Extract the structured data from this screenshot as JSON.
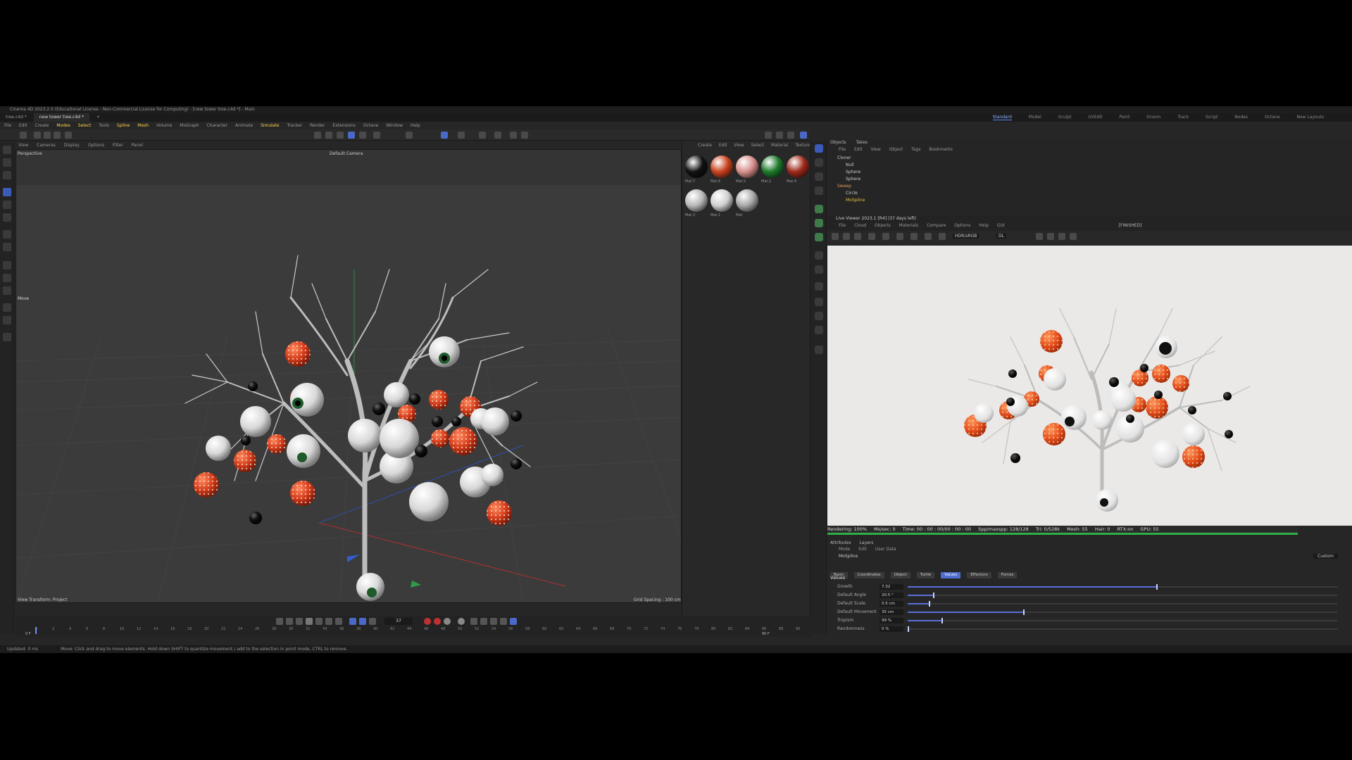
{
  "window": {
    "title": "Cinema 4D 2023.2.0 (Educational License - Non-Commercial License for Computing) - [new tower tree.c4d *] - Main"
  },
  "tabs": [
    {
      "label": "tree.c4d *"
    },
    {
      "label": "new tower tree.c4d *"
    }
  ],
  "layouts": [
    "Standard",
    "Model",
    "Sculpt",
    "UVEdit",
    "Paint",
    "Groom",
    "Track",
    "Script",
    "Nodes",
    "Octane",
    "New Layouts"
  ],
  "menubar": [
    "File",
    "Edit",
    "Create",
    "Modes",
    "Select",
    "Tools",
    "Spline",
    "Mesh",
    "Volume",
    "MoGraph",
    "Character",
    "Animate",
    "Simulate",
    "Tracker",
    "Render",
    "Extensions",
    "Octane",
    "Window",
    "Help"
  ],
  "viewport": {
    "menu": [
      "View",
      "Cameras",
      "Display",
      "Options",
      "Filter",
      "Panel"
    ],
    "label": "Perspective",
    "camera": "Default Camera",
    "move_label": "Move",
    "footer_left": "View Transform: Project",
    "footer_right": "Grid Spacing : 100 cm"
  },
  "materials": {
    "menu": [
      "Create",
      "Edit",
      "View",
      "Select",
      "Material",
      "Texture"
    ],
    "items": [
      {
        "name": "Mat.7",
        "color": "#111111"
      },
      {
        "name": "Mat.6",
        "color": "#c8421e"
      },
      {
        "name": "Mat.5",
        "color": "#d8908c"
      },
      {
        "name": "Mat.2",
        "color": "#1f7a2c"
      },
      {
        "name": "Mat.4",
        "color": "#9e2a1a"
      },
      {
        "name": "Mat.3",
        "color": "#b8b8b8"
      },
      {
        "name": "Mat.1",
        "color": "#d0d0d0"
      },
      {
        "name": "Mat",
        "color": "#a8a8a8"
      }
    ]
  },
  "objects": {
    "tabs": [
      "Objects",
      "Takes"
    ],
    "menu": [
      "File",
      "Edit",
      "View",
      "Object",
      "Tags",
      "Bookmarks"
    ],
    "rows": [
      {
        "name": "Cloner",
        "indent": 0
      },
      {
        "name": "Null",
        "indent": 1
      },
      {
        "name": "Sphere",
        "indent": 1
      },
      {
        "name": "Sphere",
        "indent": 1
      },
      {
        "name": "Sweep",
        "indent": 0,
        "color": "#e0a060"
      },
      {
        "name": "Circle",
        "indent": 1
      },
      {
        "name": "MoSpline",
        "indent": 1,
        "color": "#e8c040"
      }
    ]
  },
  "live_viewer": {
    "title": "Live Viewer 2023.1 [R4] (37 days left)",
    "menu": [
      "File",
      "Cloud",
      "Objects",
      "Materials",
      "Compare",
      "Options",
      "Help",
      "GUI"
    ],
    "finished": "[FINISHED]",
    "mode": "HDR/sRGB",
    "channel": "DL"
  },
  "render_status": {
    "rendering": "Rendering: 100%",
    "mssec": "Ms/sec: 0",
    "time": "Time: 00 : 00 : 00/00 : 00 : 00",
    "spp": "Spp/maxspp: 128/128",
    "tri": "Tri: 0/528k",
    "mesh": "Mesh: 55",
    "hair": "Hair: 0",
    "rtx": "RTX:on",
    "gpu": "GPU: 55"
  },
  "attributes": {
    "tabs": [
      "Attributes",
      "Layers"
    ],
    "mode": [
      "Mode",
      "Edit",
      "User Data"
    ],
    "object": "MoSpline",
    "preset": "Custom",
    "buttons": [
      "Basic",
      "Coordinates",
      "Object",
      "Turtle",
      "Values",
      "Effectors",
      "Forces"
    ],
    "active_button": "Values",
    "section": "Values",
    "params": [
      {
        "label": "Growth",
        "value": "7.32",
        "level": 0.58
      },
      {
        "label": "Default Angle",
        "value": "20.5 °",
        "level": 0.06
      },
      {
        "label": "Default Scale",
        "value": "0.5 cm",
        "level": 0.05
      },
      {
        "label": "Default Movement",
        "value": "35 cm",
        "level": 0.27
      },
      {
        "label": "Tropism",
        "value": "99 %",
        "level": 0.08
      },
      {
        "label": "Randomness",
        "value": "0 %",
        "level": 0.0
      }
    ]
  },
  "timeline": {
    "current_frame": "37",
    "start": "0 F",
    "end": "90 F",
    "ticks": [
      "0",
      "2",
      "4",
      "6",
      "8",
      "10",
      "12",
      "14",
      "16",
      "18",
      "20",
      "22",
      "24",
      "26",
      "28",
      "30",
      "32",
      "34",
      "36",
      "38",
      "40",
      "42",
      "44",
      "46",
      "48",
      "50",
      "52",
      "54",
      "56",
      "58",
      "60",
      "62",
      "64",
      "66",
      "68",
      "70",
      "72",
      "74",
      "76",
      "78",
      "80",
      "82",
      "84",
      "86",
      "88",
      "90"
    ]
  },
  "status": {
    "updated": "Updated: 0 ms",
    "hint": "Move: Click and drag to move elements. Hold down SHIFT to quantize movement / add to the selection in point mode, CTRL to remove."
  }
}
